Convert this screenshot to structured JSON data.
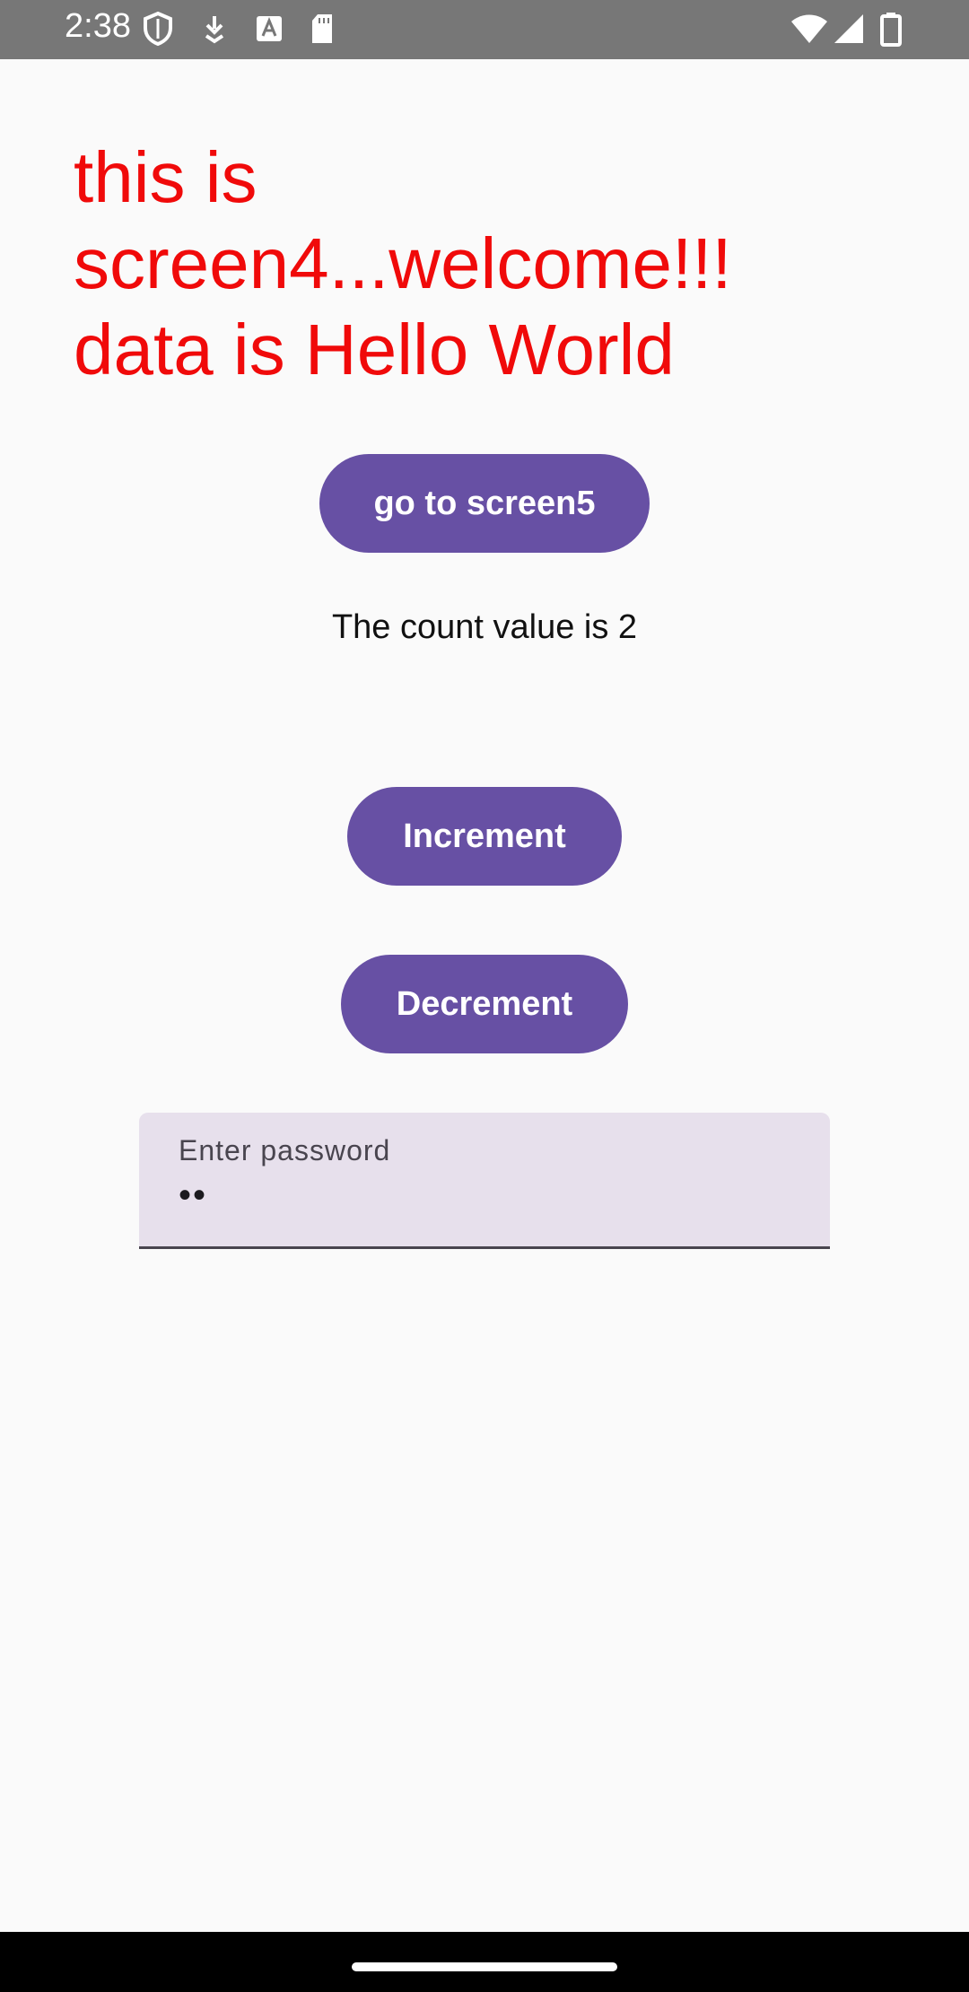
{
  "status_bar": {
    "time": "2:38",
    "icons": [
      "shield-icon",
      "download-icon",
      "font-icon",
      "sd-card-icon",
      "wifi-icon",
      "signal-icon",
      "battery-icon"
    ]
  },
  "main": {
    "heading_lines": [
      "this is",
      "screen4...welcome!!!",
      "data is Hello World"
    ],
    "go_button_label": "go to screen5",
    "count_text": "The count value is 2",
    "increment_label": "Increment",
    "decrement_label": "Decrement",
    "password_field": {
      "label": "Enter password",
      "value": "••"
    }
  },
  "colors": {
    "heading": "#f00a0a",
    "button": "#6750a4",
    "field_bg": "#e7e0ec",
    "status_bar": "#777777"
  }
}
